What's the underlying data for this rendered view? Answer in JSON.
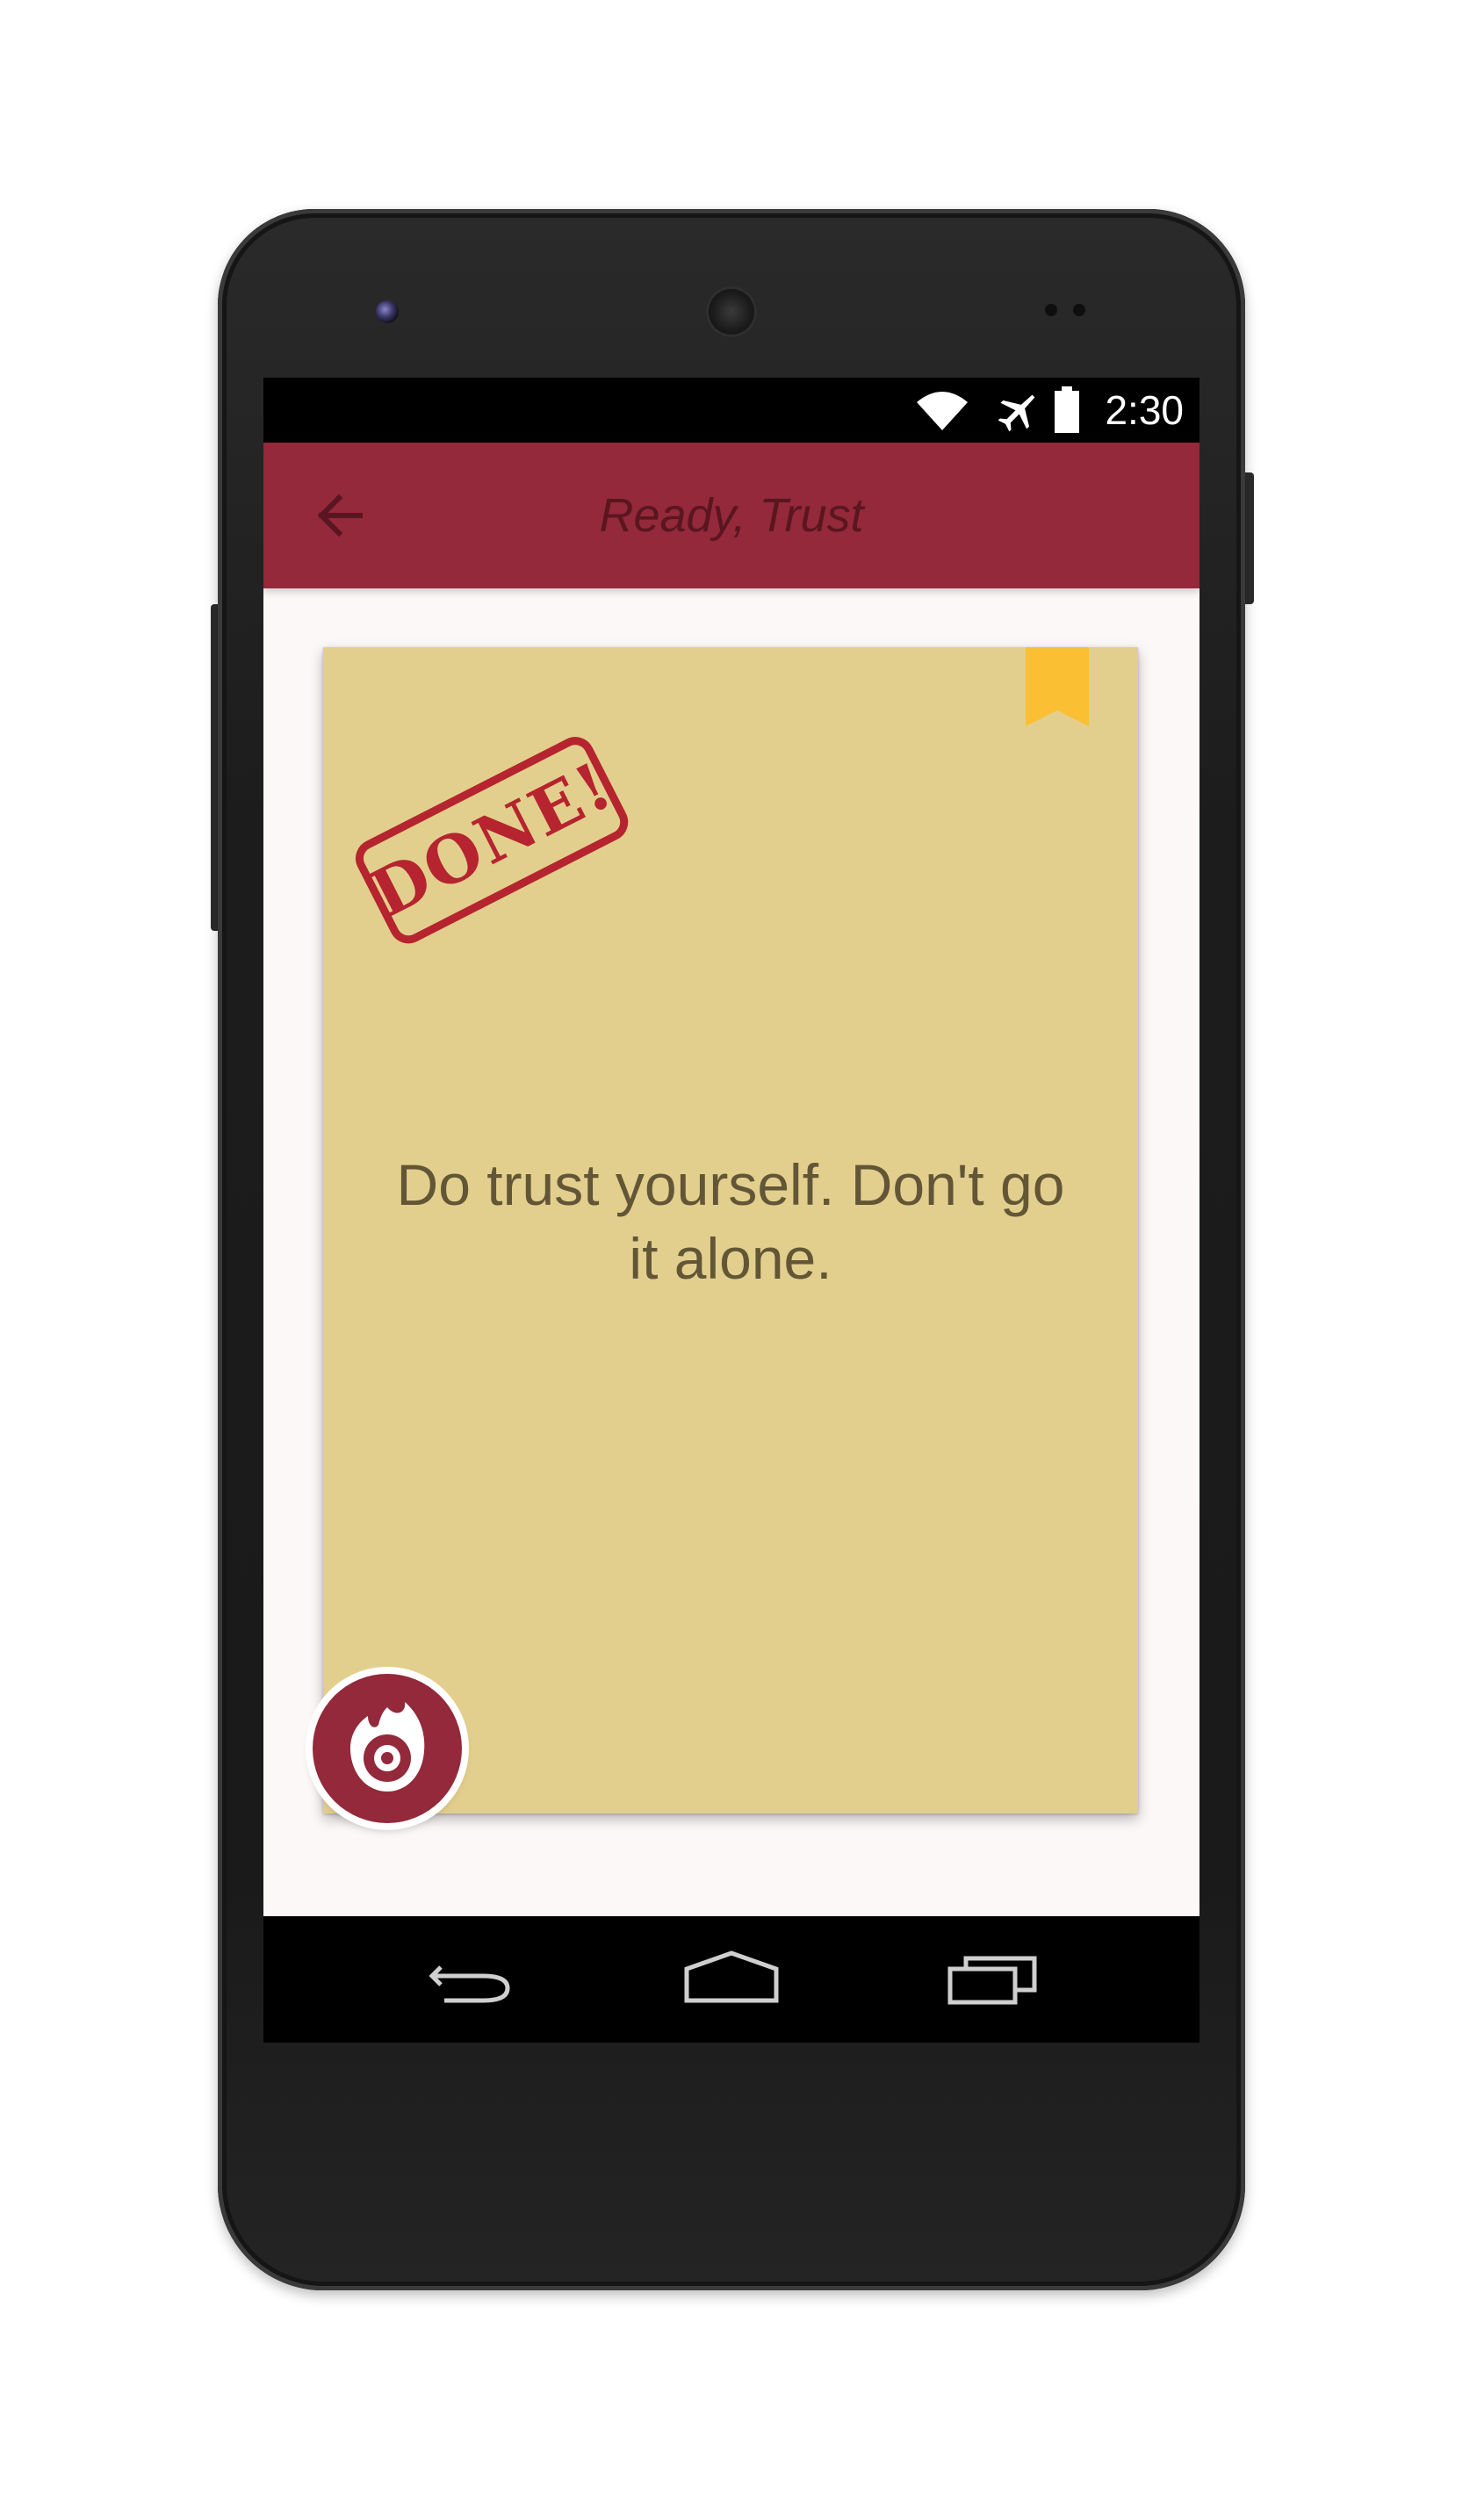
{
  "status_bar": {
    "time": "2:30",
    "icons": [
      "wifi-icon",
      "airplane-mode-icon",
      "battery-icon"
    ]
  },
  "app_bar": {
    "title": "Ready, Trust",
    "back_icon": "arrow-left-icon",
    "color": "#93293a"
  },
  "card": {
    "stamp_text": "DONE!",
    "message": "Do trust yourself. Don't go it alone.",
    "bookmark_icon": "bookmark-icon",
    "background_color": "#e3cf8d",
    "bookmark_color": "#fbbf33",
    "stamp_color": "#b5242f"
  },
  "fab": {
    "icon": "flame-target-icon",
    "color": "#93293a"
  },
  "nav_bar": {
    "buttons": [
      "back-nav-icon",
      "home-nav-icon",
      "recents-nav-icon"
    ]
  }
}
